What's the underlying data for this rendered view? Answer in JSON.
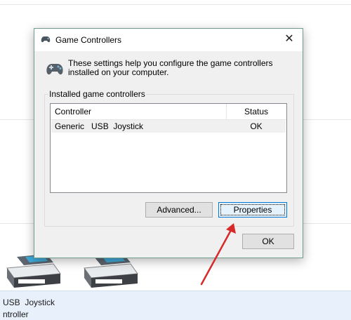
{
  "background": {
    "device_name_partial": "USB  Joystick",
    "device_category_partial": "ntroller"
  },
  "dialog": {
    "title": "Game Controllers",
    "close_label": "✕",
    "intro": "These settings help you configure the game controllers installed on your computer.",
    "group_label": "Installed game controllers",
    "list": {
      "headers": {
        "controller": "Controller",
        "status": "Status"
      },
      "rows": [
        {
          "controller": "Generic   USB  Joystick",
          "status": "OK"
        }
      ]
    },
    "buttons": {
      "advanced": "Advanced...",
      "properties": "Properties",
      "ok": "OK"
    }
  },
  "annotation": {
    "arrow_color": "#d62a2a"
  },
  "colors": {
    "dialog_background": "#f0f0f0",
    "dialog_border": "#6f9c8f",
    "focus_button_border": "#0078d7",
    "selected_row": "#f0f0f0",
    "details_pane": "#e8f1fb"
  }
}
